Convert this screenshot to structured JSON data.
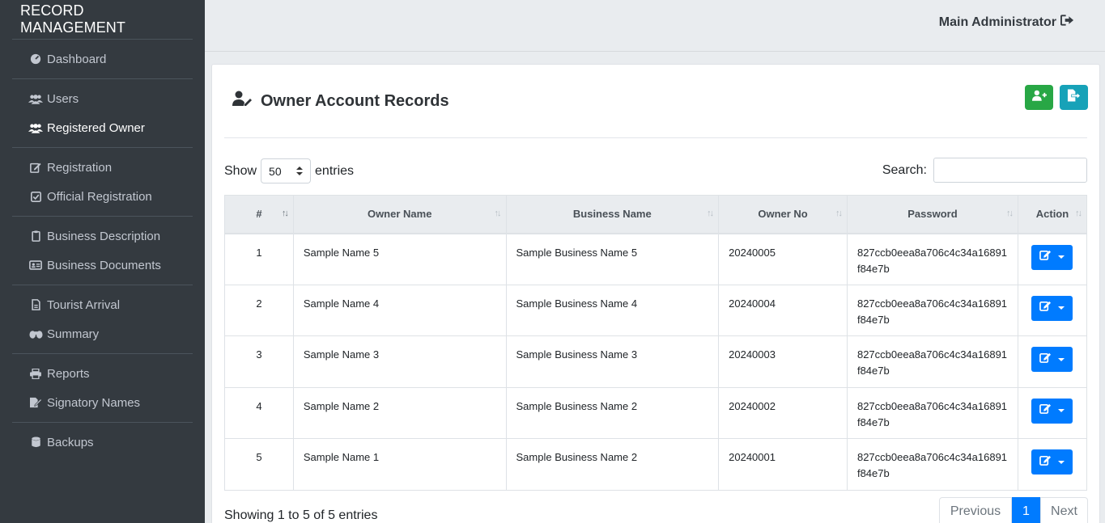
{
  "app": {
    "title": "RECORD MANAGEMENT"
  },
  "sidebar": {
    "groups": [
      {
        "items": [
          {
            "label": "Dashboard",
            "icon": "dashboard-icon"
          }
        ]
      },
      {
        "items": [
          {
            "label": "Users",
            "icon": "users-icon"
          },
          {
            "label": "Registered Owner",
            "icon": "users-icon",
            "active": true
          }
        ]
      },
      {
        "items": [
          {
            "label": "Registration",
            "icon": "edit-icon"
          },
          {
            "label": "Official Registration",
            "icon": "check-square-icon"
          }
        ]
      },
      {
        "items": [
          {
            "label": "Business Description",
            "icon": "clipboard-icon"
          },
          {
            "label": "Business Documents",
            "icon": "id-card-icon"
          }
        ]
      },
      {
        "items": [
          {
            "label": "Tourist Arrival",
            "icon": "file-icon"
          },
          {
            "label": "Summary",
            "icon": "binoculars-icon"
          }
        ]
      },
      {
        "items": [
          {
            "label": "Reports",
            "icon": "print-icon"
          },
          {
            "label": "Signatory Names",
            "icon": "signature-icon"
          }
        ]
      },
      {
        "items": [
          {
            "label": "Backups",
            "icon": "database-icon"
          }
        ]
      }
    ]
  },
  "topbar": {
    "user": "Main Administrator"
  },
  "page": {
    "title": "Owner Account Records",
    "show_label": "Show",
    "entries_value": "50",
    "entries_label": "entries",
    "search_label": "Search:",
    "search_value": "",
    "columns": [
      "#",
      "Owner Name",
      "Business Name",
      "Owner No",
      "Password",
      "Action"
    ],
    "rows": [
      {
        "num": "1",
        "owner": "Sample Name 5",
        "business": "Sample Business Name 5",
        "owner_no": "20240005",
        "pw1": "827ccb0eea8a706c4c34a16891",
        "pw2": "f84e7b"
      },
      {
        "num": "2",
        "owner": "Sample Name 4",
        "business": "Sample Business Name 4",
        "owner_no": "20240004",
        "pw1": "827ccb0eea8a706c4c34a16891",
        "pw2": "f84e7b"
      },
      {
        "num": "3",
        "owner": "Sample Name 3",
        "business": "Sample Business Name 3",
        "owner_no": "20240003",
        "pw1": "827ccb0eea8a706c4c34a16891",
        "pw2": "f84e7b"
      },
      {
        "num": "4",
        "owner": "Sample Name 2",
        "business": "Sample Business Name 2",
        "owner_no": "20240002",
        "pw1": "827ccb0eea8a706c4c34a16891",
        "pw2": "f84e7b"
      },
      {
        "num": "5",
        "owner": "Sample Name 1",
        "business": "Sample Business Name 2",
        "owner_no": "20240001",
        "pw1": "827ccb0eea8a706c4c34a16891",
        "pw2": "f84e7b"
      }
    ],
    "info": "Showing 1 to 5 of 5 entries",
    "pager": {
      "prev": "Previous",
      "current": "1",
      "next": "Next"
    }
  },
  "colors": {
    "sidebar": "#343a40",
    "primary": "#007bff",
    "success": "#28a745",
    "info": "#17a2b8"
  }
}
